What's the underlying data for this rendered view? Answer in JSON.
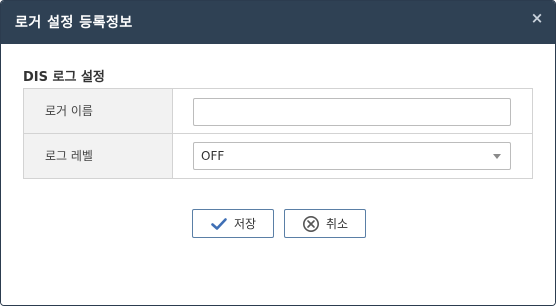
{
  "dialog": {
    "title": "로거 설정 등록정보",
    "close_label": "×"
  },
  "section": {
    "title": "DIS 로그 설정"
  },
  "form": {
    "logger_name": {
      "label": "로거 이름",
      "value": "",
      "placeholder": ""
    },
    "log_level": {
      "label": "로그 레벨",
      "selected": "OFF"
    }
  },
  "buttons": {
    "save_label": "저장",
    "cancel_label": "취소"
  },
  "colors": {
    "titlebar": "#2f4154",
    "button_border": "#5a7fa6",
    "icon_blue": "#3f6fb5",
    "label_bg": "#f2f2f2"
  },
  "icons": {
    "save": "check-icon",
    "cancel": "circle-x-icon",
    "close": "close-icon",
    "dropdown": "chevron-down-icon"
  }
}
